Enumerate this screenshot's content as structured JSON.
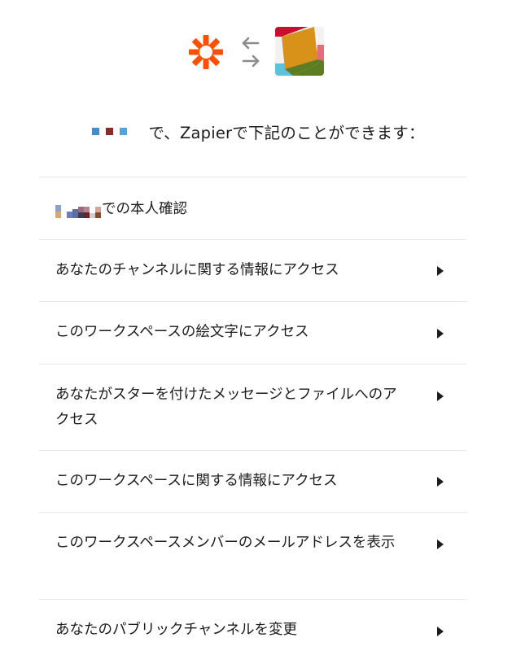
{
  "header": {
    "title_text": "で、Zapierで下記のことができます：",
    "redacted_workspace_colors": [
      "#3d8fd1",
      "#8a2b2b",
      "#4fa3e0"
    ]
  },
  "logos": {
    "left_logo": "zapier-logo",
    "swap_icon": "swap-arrows-icon",
    "right_logo": "app-logo",
    "zapier_color": "#ff4f00",
    "arrow_color": "#8c8c8c"
  },
  "permissions": {
    "identity_suffix": "での本人確認",
    "items": [
      "あなたのチャンネルに関する情報にアクセス",
      "このワークスペースの絵文字にアクセス",
      "あなたがスターを付けたメッセージとファイルへのアクセス",
      "このワークスペースに関する情報にアクセス",
      "このワークスペースメンバーのメールアドレスを表示",
      "あなたのパブリックチャンネルを変更"
    ]
  }
}
